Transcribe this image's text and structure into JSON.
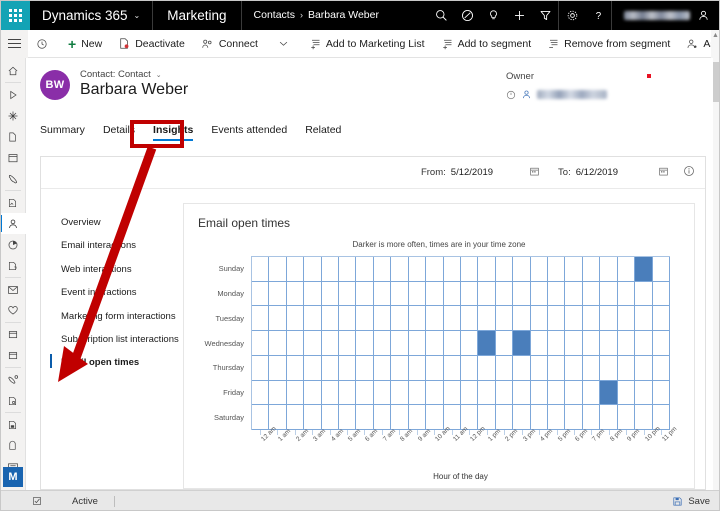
{
  "topbar": {
    "waffle_icon": "waffle-icon",
    "brand": "Dynamics 365",
    "brand_chevron": "⌄",
    "app_name": "Marketing",
    "breadcrumb": {
      "parent": "Contacts",
      "separator": "›",
      "current": "Barbara Weber"
    },
    "icons": [
      "search-icon",
      "checkmark-circle-icon",
      "lightbulb-icon",
      "plus-icon",
      "filter-icon",
      "gear-icon",
      "help-icon"
    ],
    "user_name_blurred": ""
  },
  "commandbar": {
    "hamburger": "hamburger-icon",
    "items": [
      {
        "icon": "clock-history-icon",
        "label": ""
      },
      {
        "icon": "plus-icon",
        "label": "New"
      },
      {
        "icon": "deactivate-icon",
        "label": "Deactivate"
      },
      {
        "icon": "connect-icon",
        "label": "Connect"
      },
      {
        "icon": "chevron-down-icon",
        "label": ""
      },
      {
        "icon": "add-list-icon",
        "label": "Add to Marketing List"
      },
      {
        "icon": "add-segment-icon",
        "label": "Add to segment"
      },
      {
        "icon": "remove-segment-icon",
        "label": "Remove from segment"
      },
      {
        "icon": "assign-icon",
        "label": "Assign"
      },
      {
        "icon": "overflow-icon",
        "label": "···"
      }
    ]
  },
  "rail": {
    "items": [
      "home-icon",
      "recent-icon",
      "pinned-icon",
      "document-icon",
      "calendar-icon",
      "phone-icon",
      "activity-icon",
      "contact-icon",
      "dashboard-icon",
      "report-icon",
      "email-icon",
      "heart-icon",
      "calendar-box-icon",
      "calendar-alt-icon",
      "phone-link-icon",
      "document-search-icon",
      "page-save-icon",
      "form-icon",
      "keyboard-icon"
    ],
    "badge": "M"
  },
  "record": {
    "avatar_initials": "BW",
    "type_label": "Contact: Contact",
    "type_chevron": "⌄",
    "title": "Barbara Weber",
    "owner_label": "Owner",
    "owner_lookup_icon": "lookup-icon",
    "owner_person_icon": "person-icon",
    "owner_value_blurred": ""
  },
  "tabs": [
    {
      "label": "Summary",
      "active": false
    },
    {
      "label": "Details",
      "active": false
    },
    {
      "label": "Insights",
      "active": true
    },
    {
      "label": "Events attended",
      "active": false
    },
    {
      "label": "Related",
      "active": false
    }
  ],
  "daterange": {
    "from_label": "From:",
    "from_value": "5/12/2019",
    "to_label": "To:",
    "to_value": "6/12/2019",
    "calendar_icon": "calendar-icon",
    "info_icon": "info-icon"
  },
  "insights_nav": [
    {
      "label": "Overview",
      "selected": false
    },
    {
      "label": "Email interactions",
      "selected": false
    },
    {
      "label": "Web interactions",
      "selected": false
    },
    {
      "label": "Event interactions",
      "selected": false
    },
    {
      "label": "Marketing form interactions",
      "selected": false
    },
    {
      "label": "Subscription list interactions",
      "selected": false
    },
    {
      "label": "Email open times",
      "selected": true
    }
  ],
  "chart_data": {
    "type": "heatmap",
    "title": "Email open times",
    "subtitle": "Darker is more often, times are in your time zone",
    "xlabel": "Hour of the day",
    "ylabel": "",
    "categories_x": [
      "12 am",
      "1 am",
      "2 am",
      "3 am",
      "4 am",
      "5 am",
      "6 am",
      "7 am",
      "8 am",
      "9 am",
      "10 am",
      "11 am",
      "12 pm",
      "1 pm",
      "2 pm",
      "3 pm",
      "4 pm",
      "5 pm",
      "6 pm",
      "7 pm",
      "8 pm",
      "9 pm",
      "10 pm",
      "11 pm"
    ],
    "categories_y": [
      "Sunday",
      "Monday",
      "Tuesday",
      "Wednesday",
      "Thursday",
      "Friday",
      "Saturday"
    ],
    "values": [
      [
        0,
        0,
        0,
        0,
        0,
        0,
        0,
        0,
        0,
        0,
        0,
        0,
        0,
        0,
        0,
        0,
        0,
        0,
        0,
        0,
        0,
        0,
        1,
        0
      ],
      [
        0,
        0,
        0,
        0,
        0,
        0,
        0,
        0,
        0,
        0,
        0,
        0,
        0,
        0,
        0,
        0,
        0,
        0,
        0,
        0,
        0,
        0,
        0,
        0
      ],
      [
        0,
        0,
        0,
        0,
        0,
        0,
        0,
        0,
        0,
        0,
        0,
        0,
        0,
        0,
        0,
        0,
        0,
        0,
        0,
        0,
        0,
        0,
        0,
        0
      ],
      [
        0,
        0,
        0,
        0,
        0,
        0,
        0,
        0,
        0,
        0,
        0,
        0,
        0,
        1,
        0,
        1,
        0,
        0,
        0,
        0,
        0,
        0,
        0,
        0
      ],
      [
        0,
        0,
        0,
        0,
        0,
        0,
        0,
        0,
        0,
        0,
        0,
        0,
        0,
        0,
        0,
        0,
        0,
        0,
        0,
        0,
        0,
        0,
        0,
        0
      ],
      [
        0,
        0,
        0,
        0,
        0,
        0,
        0,
        0,
        0,
        0,
        0,
        0,
        0,
        0,
        0,
        0,
        0,
        0,
        0,
        0,
        1,
        0,
        0,
        0
      ],
      [
        0,
        0,
        0,
        0,
        0,
        0,
        0,
        0,
        0,
        0,
        0,
        0,
        0,
        0,
        0,
        0,
        0,
        0,
        0,
        0,
        0,
        0,
        0,
        0
      ]
    ],
    "colors": {
      "filled": "#4a7ebb",
      "empty": "#ffffff",
      "gridline": "#7da7d9"
    },
    "grid": true,
    "legend": "none"
  },
  "annotations": {
    "highlight_target": "Insights",
    "arrow_target": "Email open times",
    "color": "#c00000"
  },
  "statusbar": {
    "lock_icon": "edit-state-icon",
    "state": "Active",
    "save_icon": "save-icon",
    "save_label": "Save"
  }
}
